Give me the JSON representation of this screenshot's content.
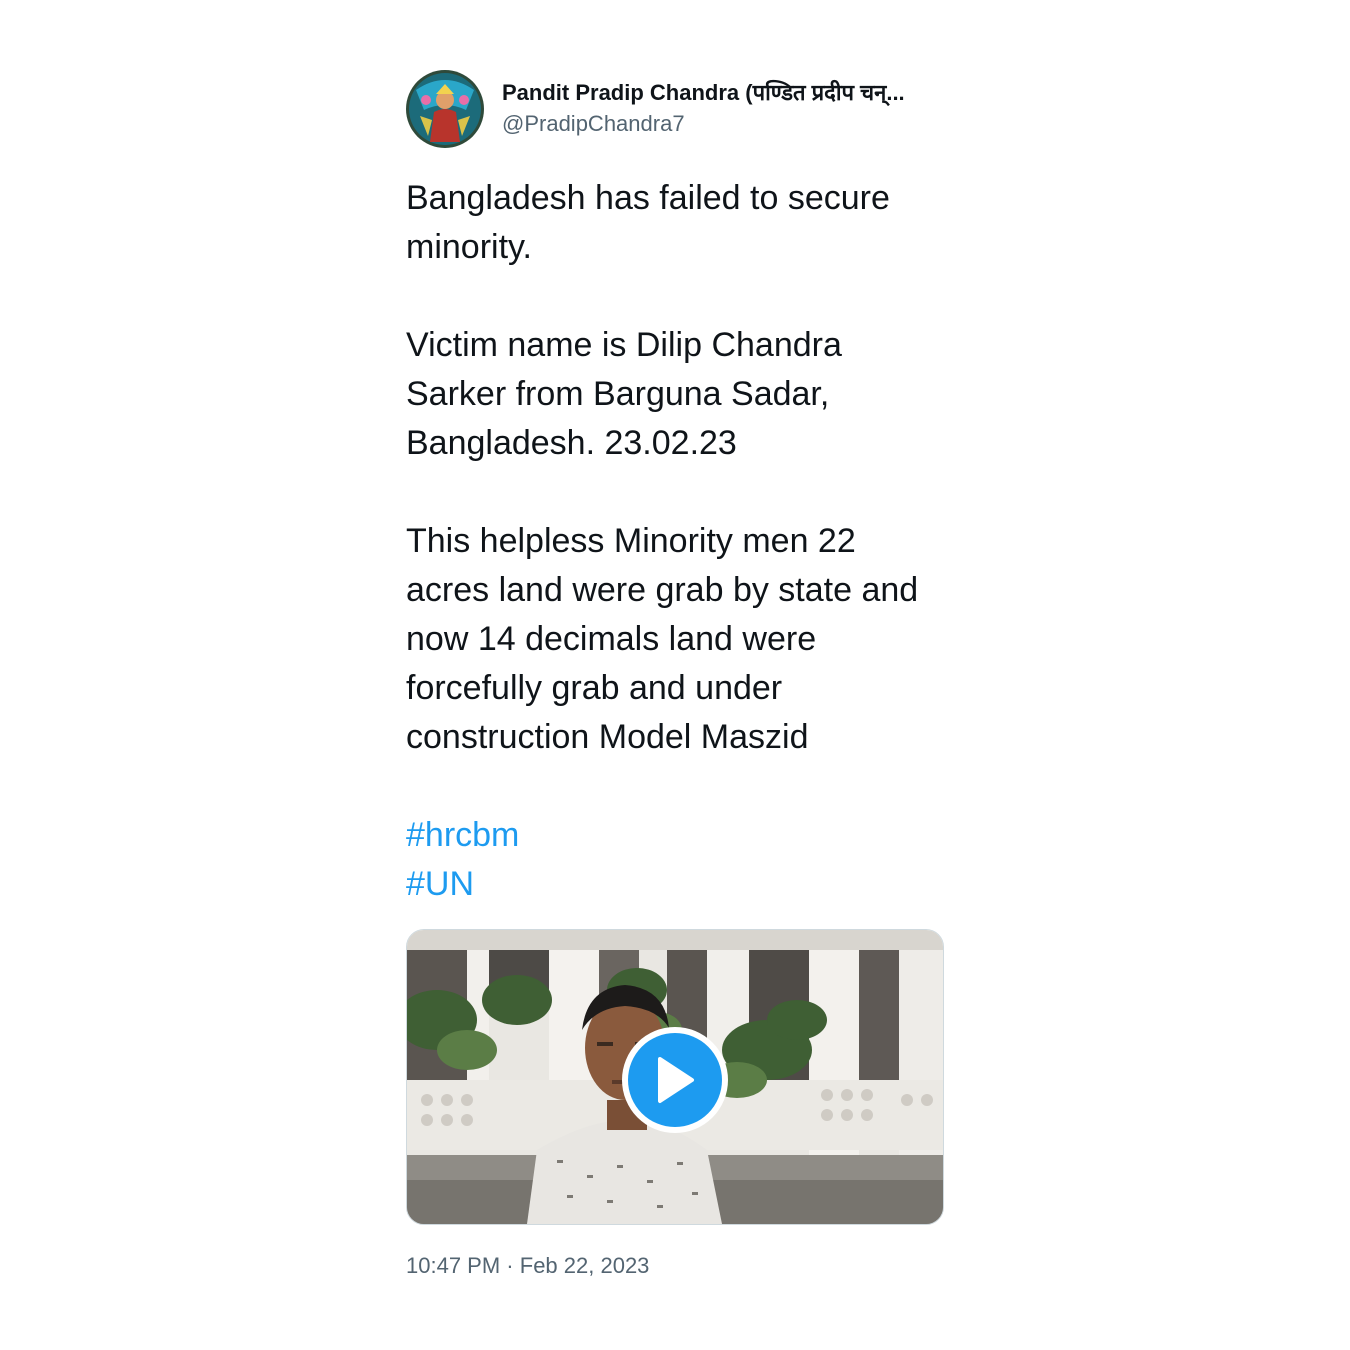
{
  "author": {
    "display_name": "Pandit Pradip Chandra (पण्डित प्रदीप चन्...",
    "handle": "@PradipChandra7",
    "avatar_icon": "avatar-image"
  },
  "tweet": {
    "paragraphs": [
      "Bangladesh has failed to secure minority.",
      "Victim name is Dilip Chandra Sarker from Barguna Sadar, Bangladesh. 23.02.23",
      "This helpless Minority men 22 acres land were grab by state and now 14 decimals land were forcefully grab and under construction Model Maszid"
    ],
    "hashtags": [
      "#hrcbm",
      "#UN"
    ]
  },
  "media": {
    "type": "video",
    "play_icon": "play-icon",
    "accent_color": "#1d9bf0"
  },
  "meta": {
    "time": "10:47 PM",
    "separator": "·",
    "date": "Feb 22, 2023"
  },
  "colors": {
    "text": "#0f1419",
    "secondary": "#536471",
    "link": "#1d9bf0",
    "border": "#cfd9de"
  }
}
